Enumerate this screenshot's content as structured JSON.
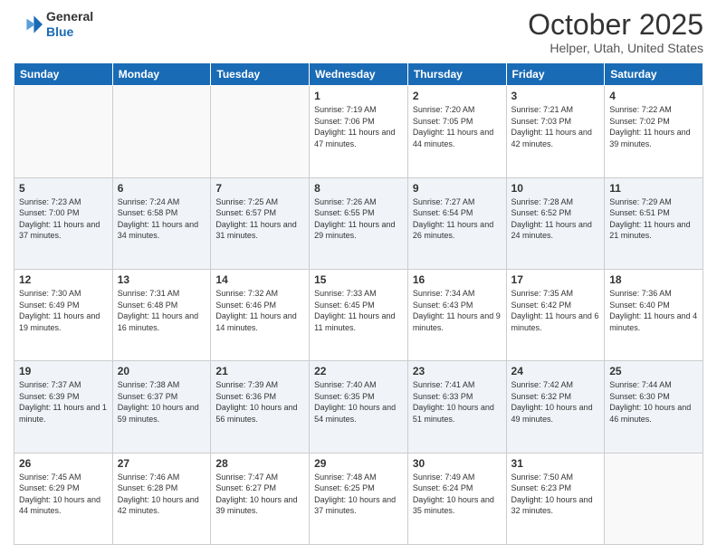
{
  "header": {
    "logo": {
      "line1": "General",
      "line2": "Blue"
    },
    "title": "October 2025",
    "location": "Helper, Utah, United States"
  },
  "days_of_week": [
    "Sunday",
    "Monday",
    "Tuesday",
    "Wednesday",
    "Thursday",
    "Friday",
    "Saturday"
  ],
  "weeks": [
    [
      {
        "day": "",
        "info": ""
      },
      {
        "day": "",
        "info": ""
      },
      {
        "day": "",
        "info": ""
      },
      {
        "day": "1",
        "info": "Sunrise: 7:19 AM\nSunset: 7:06 PM\nDaylight: 11 hours\nand 47 minutes."
      },
      {
        "day": "2",
        "info": "Sunrise: 7:20 AM\nSunset: 7:05 PM\nDaylight: 11 hours\nand 44 minutes."
      },
      {
        "day": "3",
        "info": "Sunrise: 7:21 AM\nSunset: 7:03 PM\nDaylight: 11 hours\nand 42 minutes."
      },
      {
        "day": "4",
        "info": "Sunrise: 7:22 AM\nSunset: 7:02 PM\nDaylight: 11 hours\nand 39 minutes."
      }
    ],
    [
      {
        "day": "5",
        "info": "Sunrise: 7:23 AM\nSunset: 7:00 PM\nDaylight: 11 hours\nand 37 minutes."
      },
      {
        "day": "6",
        "info": "Sunrise: 7:24 AM\nSunset: 6:58 PM\nDaylight: 11 hours\nand 34 minutes."
      },
      {
        "day": "7",
        "info": "Sunrise: 7:25 AM\nSunset: 6:57 PM\nDaylight: 11 hours\nand 31 minutes."
      },
      {
        "day": "8",
        "info": "Sunrise: 7:26 AM\nSunset: 6:55 PM\nDaylight: 11 hours\nand 29 minutes."
      },
      {
        "day": "9",
        "info": "Sunrise: 7:27 AM\nSunset: 6:54 PM\nDaylight: 11 hours\nand 26 minutes."
      },
      {
        "day": "10",
        "info": "Sunrise: 7:28 AM\nSunset: 6:52 PM\nDaylight: 11 hours\nand 24 minutes."
      },
      {
        "day": "11",
        "info": "Sunrise: 7:29 AM\nSunset: 6:51 PM\nDaylight: 11 hours\nand 21 minutes."
      }
    ],
    [
      {
        "day": "12",
        "info": "Sunrise: 7:30 AM\nSunset: 6:49 PM\nDaylight: 11 hours\nand 19 minutes."
      },
      {
        "day": "13",
        "info": "Sunrise: 7:31 AM\nSunset: 6:48 PM\nDaylight: 11 hours\nand 16 minutes."
      },
      {
        "day": "14",
        "info": "Sunrise: 7:32 AM\nSunset: 6:46 PM\nDaylight: 11 hours\nand 14 minutes."
      },
      {
        "day": "15",
        "info": "Sunrise: 7:33 AM\nSunset: 6:45 PM\nDaylight: 11 hours\nand 11 minutes."
      },
      {
        "day": "16",
        "info": "Sunrise: 7:34 AM\nSunset: 6:43 PM\nDaylight: 11 hours\nand 9 minutes."
      },
      {
        "day": "17",
        "info": "Sunrise: 7:35 AM\nSunset: 6:42 PM\nDaylight: 11 hours\nand 6 minutes."
      },
      {
        "day": "18",
        "info": "Sunrise: 7:36 AM\nSunset: 6:40 PM\nDaylight: 11 hours\nand 4 minutes."
      }
    ],
    [
      {
        "day": "19",
        "info": "Sunrise: 7:37 AM\nSunset: 6:39 PM\nDaylight: 11 hours\nand 1 minute."
      },
      {
        "day": "20",
        "info": "Sunrise: 7:38 AM\nSunset: 6:37 PM\nDaylight: 10 hours\nand 59 minutes."
      },
      {
        "day": "21",
        "info": "Sunrise: 7:39 AM\nSunset: 6:36 PM\nDaylight: 10 hours\nand 56 minutes."
      },
      {
        "day": "22",
        "info": "Sunrise: 7:40 AM\nSunset: 6:35 PM\nDaylight: 10 hours\nand 54 minutes."
      },
      {
        "day": "23",
        "info": "Sunrise: 7:41 AM\nSunset: 6:33 PM\nDaylight: 10 hours\nand 51 minutes."
      },
      {
        "day": "24",
        "info": "Sunrise: 7:42 AM\nSunset: 6:32 PM\nDaylight: 10 hours\nand 49 minutes."
      },
      {
        "day": "25",
        "info": "Sunrise: 7:44 AM\nSunset: 6:30 PM\nDaylight: 10 hours\nand 46 minutes."
      }
    ],
    [
      {
        "day": "26",
        "info": "Sunrise: 7:45 AM\nSunset: 6:29 PM\nDaylight: 10 hours\nand 44 minutes."
      },
      {
        "day": "27",
        "info": "Sunrise: 7:46 AM\nSunset: 6:28 PM\nDaylight: 10 hours\nand 42 minutes."
      },
      {
        "day": "28",
        "info": "Sunrise: 7:47 AM\nSunset: 6:27 PM\nDaylight: 10 hours\nand 39 minutes."
      },
      {
        "day": "29",
        "info": "Sunrise: 7:48 AM\nSunset: 6:25 PM\nDaylight: 10 hours\nand 37 minutes."
      },
      {
        "day": "30",
        "info": "Sunrise: 7:49 AM\nSunset: 6:24 PM\nDaylight: 10 hours\nand 35 minutes."
      },
      {
        "day": "31",
        "info": "Sunrise: 7:50 AM\nSunset: 6:23 PM\nDaylight: 10 hours\nand 32 minutes."
      },
      {
        "day": "",
        "info": ""
      }
    ]
  ]
}
